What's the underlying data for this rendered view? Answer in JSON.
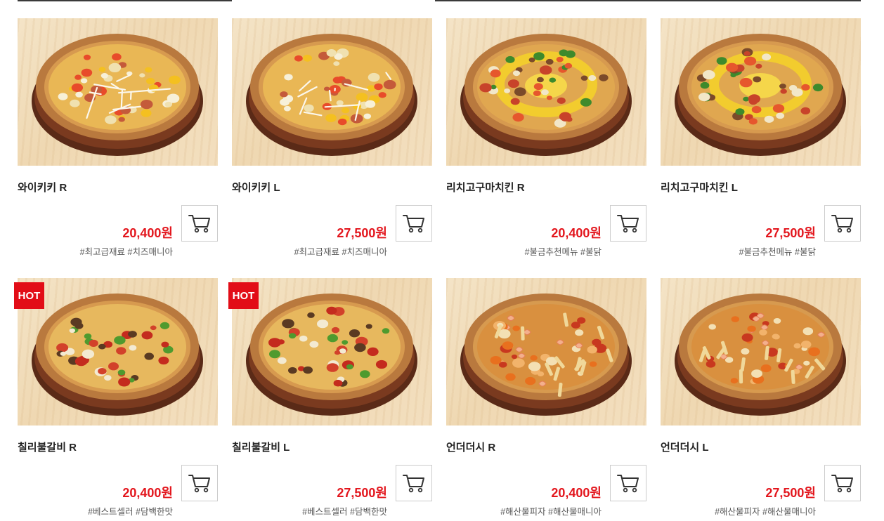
{
  "products": [
    {
      "name": "와이키키 R",
      "price": "20,400원",
      "tags": "#최고급재료 #치즈매니아",
      "hot": false,
      "topping": "waikiki"
    },
    {
      "name": "와이키키 L",
      "price": "27,500원",
      "tags": "#최고급재료 #치즈매니아",
      "hot": false,
      "topping": "waikiki"
    },
    {
      "name": "리치고구마치킨 R",
      "price": "20,400원",
      "tags": "#불금추천메뉴 #불닭",
      "hot": false,
      "topping": "sweetpotato"
    },
    {
      "name": "리치고구마치킨 L",
      "price": "27,500원",
      "tags": "#불금추천메뉴 #불닭",
      "hot": false,
      "topping": "sweetpotato"
    },
    {
      "name": "칠리불갈비 R",
      "price": "20,400원",
      "tags": "#베스트셀러 #담백한맛",
      "hot": true,
      "topping": "galbi"
    },
    {
      "name": "칠리불갈비 L",
      "price": "27,500원",
      "tags": "#베스트셀러 #담백한맛",
      "hot": true,
      "topping": "galbi"
    },
    {
      "name": "언더더시 R",
      "price": "20,400원",
      "tags": "#해산물피자 #해산물매니아",
      "hot": false,
      "topping": "seafood"
    },
    {
      "name": "언더더시 L",
      "price": "27,500원",
      "tags": "#해산물피자 #해산물매니아",
      "hot": false,
      "topping": "seafood"
    }
  ],
  "badge_label": "HOT",
  "cart_icon": "shopping-cart-icon",
  "colors": {
    "price": "#e3161d",
    "badge": "#e20d17"
  }
}
